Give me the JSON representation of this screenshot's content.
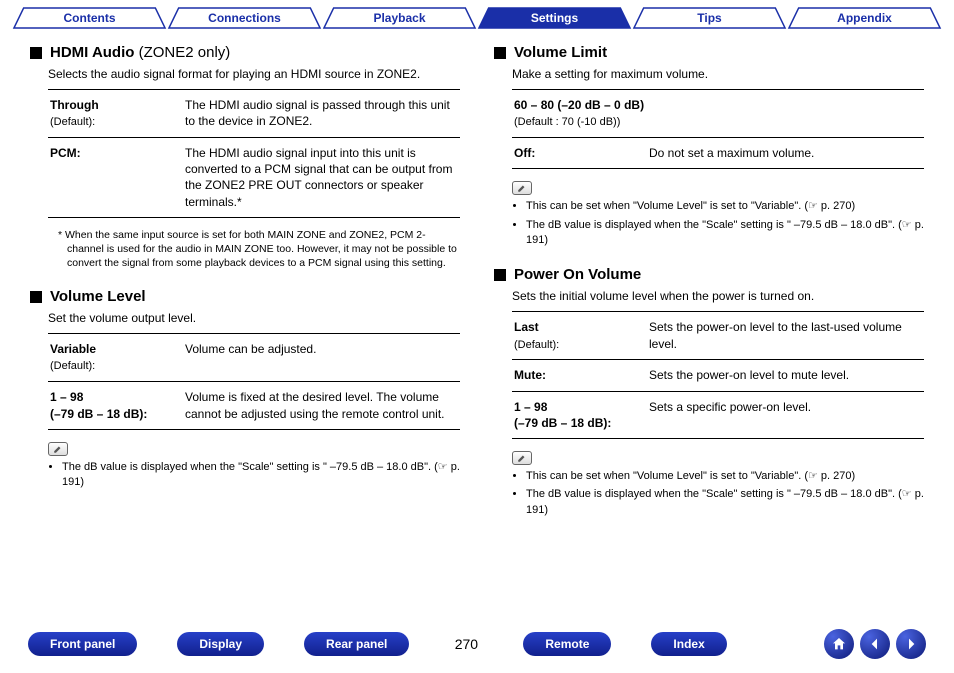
{
  "tabs": [
    {
      "label": "Contents",
      "active": false
    },
    {
      "label": "Connections",
      "active": false
    },
    {
      "label": "Playback",
      "active": false
    },
    {
      "label": "Settings",
      "active": true
    },
    {
      "label": "Tips",
      "active": false
    },
    {
      "label": "Appendix",
      "active": false
    }
  ],
  "left": {
    "hdmi": {
      "title_strong": "HDMI Audio",
      "title_light": "(ZONE2 only)",
      "desc": "Selects the audio signal format for playing an HDMI source in ZONE2.",
      "rows": [
        {
          "k": "Through",
          "def": "(Default):",
          "v": "The HDMI audio signal is passed through this unit to the device in ZONE2."
        },
        {
          "k": "PCM:",
          "def": "",
          "v": "The HDMI audio signal input into this unit is converted to a PCM signal that can be output from the ZONE2 PRE OUT connectors or speaker terminals.*"
        }
      ],
      "foot": "* When the same input source is set for both MAIN ZONE and ZONE2, PCM 2-channel is used for the audio in MAIN ZONE too. However, it may not be possible to convert the signal from some playback devices to a PCM signal using this setting."
    },
    "vlevel": {
      "title": "Volume Level",
      "desc": "Set the volume output level.",
      "rows": [
        {
          "k": "Variable",
          "def": "(Default):",
          "v": "Volume can be adjusted."
        },
        {
          "k": "1 – 98\n(–79 dB – 18 dB):",
          "def": "",
          "v": "Volume is fixed at the desired level. The volume cannot be adjusted using the remote control unit."
        }
      ],
      "notes": [
        "The dB value is displayed when the \"Scale\" setting is \" –79.5 dB – 18.0 dB\". (☞ p. 191)"
      ]
    }
  },
  "right": {
    "vlimit": {
      "title": "Volume Limit",
      "desc": "Make a setting for maximum volume.",
      "rows": [
        {
          "k": "60 – 80 (–20 dB – 0 dB)",
          "def": "(Default : 70 (-10 dB))",
          "v": ""
        },
        {
          "k": "Off:",
          "def": "",
          "v": "Do not set a maximum volume."
        }
      ],
      "notes": [
        "This can be set when \"Volume Level\" is set to \"Variable\". (☞ p. 270)",
        "The dB value is displayed when the \"Scale\" setting is \" –79.5 dB – 18.0 dB\". (☞ p. 191)"
      ]
    },
    "pon": {
      "title": "Power On Volume",
      "desc": "Sets the initial volume level when the power is turned on.",
      "rows": [
        {
          "k": "Last",
          "def": "(Default):",
          "v": "Sets the power-on level to the last-used volume level."
        },
        {
          "k": "Mute:",
          "def": "",
          "v": "Sets the power-on level to mute level."
        },
        {
          "k": "1 – 98\n(–79 dB – 18 dB):",
          "def": "",
          "v": "Sets a specific power-on level."
        }
      ],
      "notes": [
        "This can be set when \"Volume Level\" is set to \"Variable\". (☞ p. 270)",
        "The dB value is displayed when the \"Scale\" setting is \" –79.5 dB – 18.0 dB\". (☞ p. 191)"
      ]
    }
  },
  "bottom": {
    "buttons": [
      "Front panel",
      "Display",
      "Rear panel"
    ],
    "page": "270",
    "buttons2": [
      "Remote",
      "Index"
    ]
  }
}
